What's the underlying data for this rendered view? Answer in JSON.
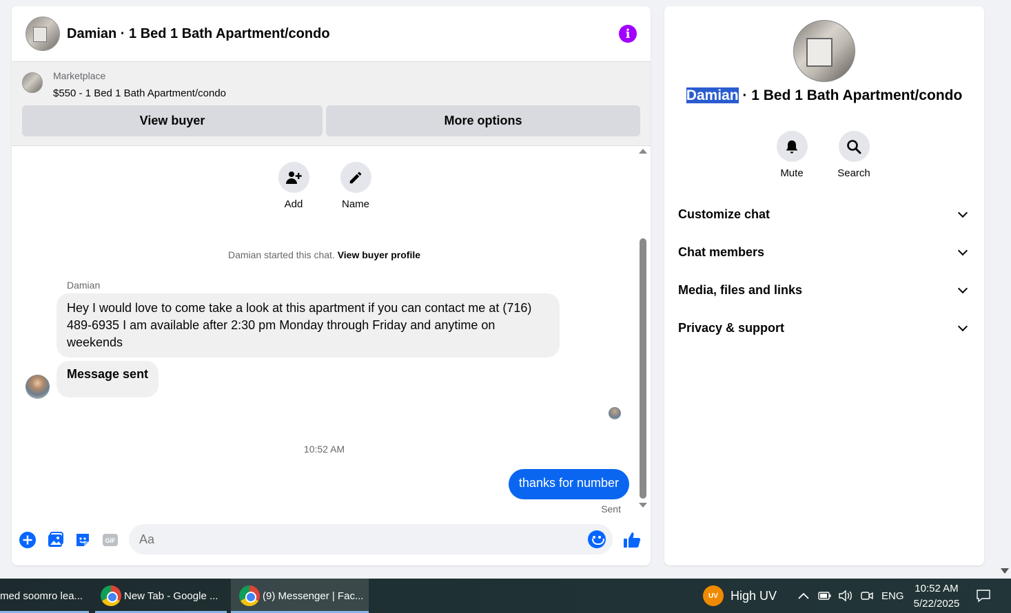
{
  "chat": {
    "title": "Damian · 1 Bed 1 Bath Apartment/condo",
    "marketplace_label": "Marketplace",
    "listing": "$550 - 1 Bed 1 Bath Apartment/condo",
    "view_buyer": "View buyer",
    "more_options": "More options",
    "actions": [
      {
        "label": "Add",
        "icon": "add-person-icon"
      },
      {
        "label": "Name",
        "icon": "pencil-icon"
      }
    ],
    "started_text": "Damian started this chat.",
    "view_buyer_profile": "View buyer profile",
    "sender_name": "Damian",
    "incoming_message": "Hey I would love to come take a look at this apartment if you can contact me at (716) 489-6935 I am available after 2:30 pm Monday through Friday and anytime on weekends",
    "message_sent": "Message sent",
    "timestamp": "10:52 AM",
    "outgoing_message": "thanks for number",
    "sent_status": "Sent",
    "input_placeholder": "Aa"
  },
  "info": {
    "name_highlight": "Damian",
    "title_rest": " · 1 Bed 1 Bath Apartment/condo",
    "mute": "Mute",
    "search": "Search",
    "sections": [
      "Customize chat",
      "Chat members",
      "Media, files and links",
      "Privacy & support"
    ]
  },
  "taskbar": {
    "tasks": [
      "med soomro lea...",
      "New Tab - Google ...",
      "(9) Messenger | Fac..."
    ],
    "uv_badge": "UV",
    "uv_text": "High UV",
    "lang": "ENG",
    "time": "10:52 AM",
    "date": "5/22/2025"
  },
  "colors": {
    "accent": "#0866ff",
    "info_purple": "#a100ff",
    "outgoing_bubble": "#0a66f0"
  }
}
